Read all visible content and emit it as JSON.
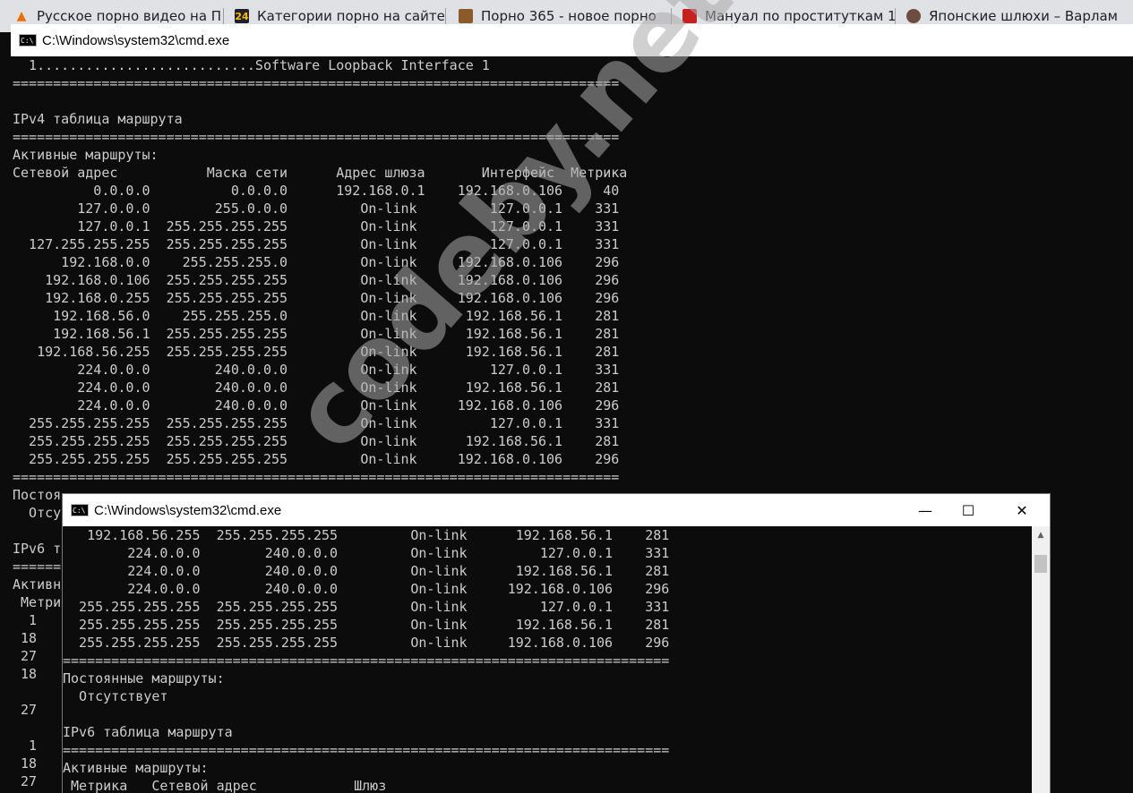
{
  "browser": {
    "tabs": [
      {
        "title": "Русское порно видео на П",
        "icon": "cone-icon",
        "icon_color": "#e8710a"
      },
      {
        "title": "Категории порно на сайте",
        "icon": "site-24-icon",
        "icon_color": "#202124",
        "icon_text": "24"
      },
      {
        "title": "Порно 365 - новое порно",
        "icon": "site-365-icon",
        "icon_color": "#8a5a2b"
      },
      {
        "title": "Мануал по проституткам 1",
        "icon": "site-manual-icon",
        "icon_color": "#c5221f"
      },
      {
        "title": "Японские шлюхи – Варлам",
        "icon": "site-avatar-icon",
        "icon_color": "#6d4c41"
      }
    ]
  },
  "back_window": {
    "title": "C:\\Windows\\system32\\cmd.exe",
    "lines": [
      "  1...........................Software Loopback Interface 1",
      "===========================================================================",
      "",
      "IPv4 таблица маршрута",
      "===========================================================================",
      "Активные маршруты:",
      "Сетевой адрес           Маска сети      Адрес шлюза       Интерфейс  Метрика",
      "          0.0.0.0          0.0.0.0      192.168.0.1    192.168.0.106     40",
      "        127.0.0.0        255.0.0.0         On-link         127.0.0.1    331",
      "        127.0.0.1  255.255.255.255         On-link         127.0.0.1    331",
      "  127.255.255.255  255.255.255.255         On-link         127.0.0.1    331",
      "      192.168.0.0    255.255.255.0         On-link     192.168.0.106    296",
      "    192.168.0.106  255.255.255.255         On-link     192.168.0.106    296",
      "    192.168.0.255  255.255.255.255         On-link     192.168.0.106    296",
      "     192.168.56.0    255.255.255.0         On-link      192.168.56.1    281",
      "     192.168.56.1  255.255.255.255         On-link      192.168.56.1    281",
      "   192.168.56.255  255.255.255.255         On-link      192.168.56.1    281",
      "        224.0.0.0        240.0.0.0         On-link         127.0.0.1    331",
      "        224.0.0.0        240.0.0.0         On-link      192.168.56.1    281",
      "        224.0.0.0        240.0.0.0         On-link     192.168.0.106    296",
      "  255.255.255.255  255.255.255.255         On-link         127.0.0.1    331",
      "  255.255.255.255  255.255.255.255         On-link      192.168.56.1    281",
      "  255.255.255.255  255.255.255.255         On-link     192.168.0.106    296",
      "===========================================================================",
      "Постоя",
      "  Отсу",
      "",
      "IPv6 т",
      "======",
      "Активн",
      " Метри",
      "  1",
      " 18",
      " 27",
      " 18",
      "",
      " 27",
      "",
      "  1",
      " 18",
      " 27"
    ]
  },
  "front_window": {
    "title": "C:\\Windows\\system32\\cmd.exe",
    "minimize": "—",
    "maximize": "☐",
    "close": "✕",
    "lines": [
      "   192.168.56.255  255.255.255.255         On-link      192.168.56.1    281",
      "        224.0.0.0        240.0.0.0         On-link         127.0.0.1    331",
      "        224.0.0.0        240.0.0.0         On-link      192.168.56.1    281",
      "        224.0.0.0        240.0.0.0         On-link     192.168.0.106    296",
      "  255.255.255.255  255.255.255.255         On-link         127.0.0.1    331",
      "  255.255.255.255  255.255.255.255         On-link      192.168.56.1    281",
      "  255.255.255.255  255.255.255.255         On-link     192.168.0.106    296",
      "===========================================================================",
      "Постоянные маршруты:",
      "  Отсутствует",
      "",
      "IPv6 таблица маршрута",
      "===========================================================================",
      "Активные маршруты:",
      " Метрика   Сетевой адрес            Шлюз"
    ]
  },
  "watermark": "codeby.net"
}
